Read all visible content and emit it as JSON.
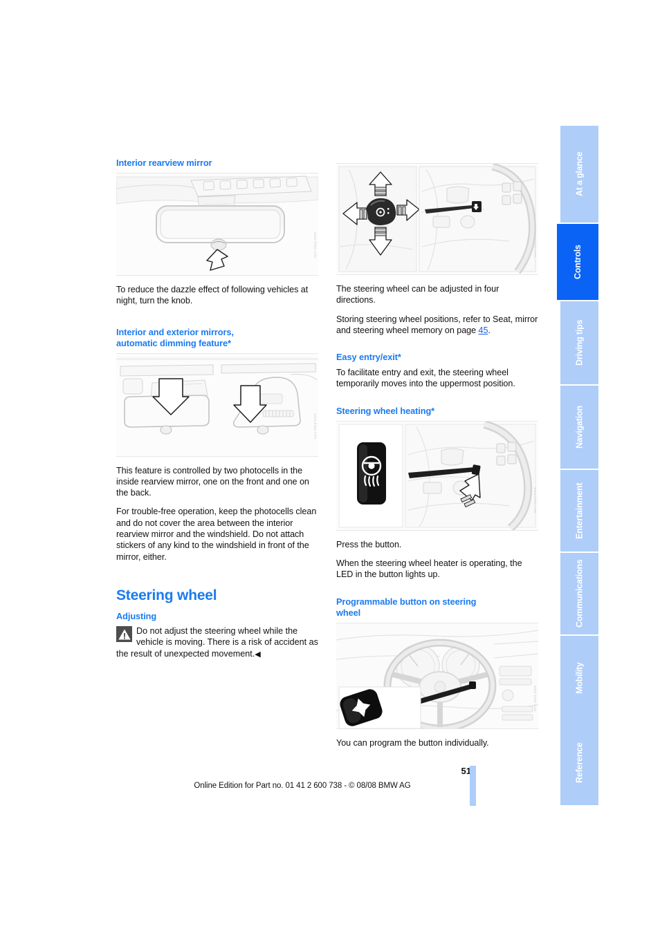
{
  "page": {
    "number": "51",
    "edition_line": "Online Edition for Part no. 01 41 2 600 738 - © 08/08 BMW AG"
  },
  "left_column": {
    "heading_rearview": "Interior rearview mirror",
    "fig_rearview_watermark": "www.bmw.com",
    "para_rearview": "To reduce the dazzle effect of following vehicles at night, turn the knob.",
    "heading_dimming_line1": "Interior and exterior mirrors,",
    "heading_dimming_line2": "automatic dimming feature*",
    "fig_dimming_watermark": "www.bmw.com",
    "para_dimming_1": "This feature is controlled by two photocells in the inside rearview mirror, one on the front and one on the back.",
    "para_dimming_2": "For trouble-free operation, keep the photocells clean and do not cover the area between the interior rearview mirror and the windshield. Do not attach stickers of any kind to the windshield in front of the mirror, either.",
    "heading_steering_wheel": "Steering wheel",
    "heading_adjusting": "Adjusting",
    "warning_text": "Do not adjust the steering wheel while the vehicle is moving. There is a risk of accident as the result of unexpected movement.",
    "warning_endmark": "◀",
    "warning_icon": "warning-triangle-icon"
  },
  "right_column": {
    "fig_adjust_watermark": "www.bmw.com",
    "para_adjust_1": "The steering wheel can be adjusted in four directions.",
    "para_adjust_2_before": "Storing steering wheel positions, refer to Seat, mirror and steering wheel memory on page ",
    "para_adjust_2_xref": "45",
    "para_adjust_2_after": ".",
    "heading_easy_entry": "Easy entry/exit*",
    "para_easy_entry": "To facilitate entry and exit, the steering wheel temporarily moves into the uppermost position.",
    "heading_wheel_heating": "Steering wheel heating*",
    "fig_heating_watermark": "www.bmw.com",
    "para_heating_1": "Press the button.",
    "para_heating_2": "When the steering wheel heater is operating, the LED in the button lights up.",
    "heading_programmable_line1": "Programmable button on steering",
    "heading_programmable_line2": "wheel",
    "fig_programmable_watermark": "www.bmw.com",
    "para_programmable": "You can program the button individually."
  },
  "sidebar": {
    "tabs": [
      {
        "label": "At a glance",
        "active": false
      },
      {
        "label": "Controls",
        "active": true
      },
      {
        "label": "Driving tips",
        "active": false
      },
      {
        "label": "Navigation",
        "active": false
      },
      {
        "label": "Entertainment",
        "active": false
      },
      {
        "label": "Communications",
        "active": false
      },
      {
        "label": "Mobility",
        "active": false
      },
      {
        "label": "Reference",
        "active": false
      }
    ]
  },
  "colors": {
    "heading_blue": "#1a7bf0",
    "tab_inactive": "#aecdf8",
    "tab_active": "#0b63f6",
    "xref_blue": "#1a5df0"
  }
}
